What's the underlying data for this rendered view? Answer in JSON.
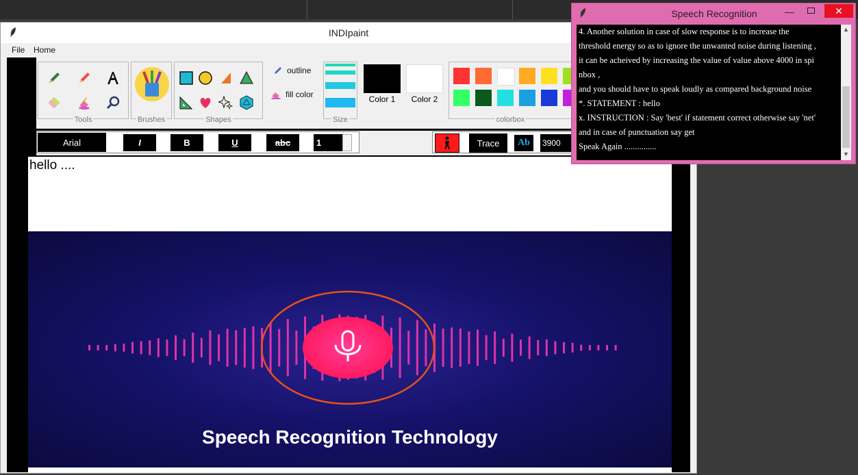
{
  "main_window": {
    "title": "INDIpaint"
  },
  "menu": {
    "file": "File",
    "home": "Home"
  },
  "ribbon": {
    "tools_label": "Tools",
    "brushes_label": "Brushes",
    "shapes_label": "Shapes",
    "outline_label": "outline",
    "fill_label": "fill color",
    "size_label": "Size",
    "color1_label": "Color 1",
    "color2_label": "Color 2",
    "colorbox_label": "colorbox",
    "color1": "#000000",
    "color2": "#ffffff",
    "palette_row1": [
      "#ff3333",
      "#ff6a33",
      "#ffffff",
      "#ffaa22",
      "#ffe020",
      "#a0e020"
    ],
    "palette_row2": [
      "#33ff66",
      "#0a5a1e",
      "#22e0e0",
      "#1aa0e0",
      "#1a3ad8",
      "#c020e0"
    ]
  },
  "format_bar": {
    "font": "Arial",
    "italic": "I",
    "bold": "B",
    "underline": "U",
    "strike": "abc",
    "size_value": "1",
    "trace": "Trace",
    "ab": "Ab",
    "energy_value": "3900"
  },
  "canvas": {
    "text": "hello ....",
    "banner_title": "Speech Recognition Technology"
  },
  "speech_window": {
    "title": "Speech Recognition",
    "lines": [
      " 4. Another solution in case of slow response is to increase the",
      "threshold energy so as to ignore the unwanted noise during listening ,",
      "it can be acheived by increasing the value of value above 4000 in spi",
      "nbox ,",
      " and you should have to speak loudly as compared background noise",
      "*. STATEMENT :  hello",
      "x. INSTRUCTION :  Say 'best' if statement correct otherwise say 'net'",
      "and in case of punctuation say get",
      " Speak Again ..............."
    ]
  }
}
